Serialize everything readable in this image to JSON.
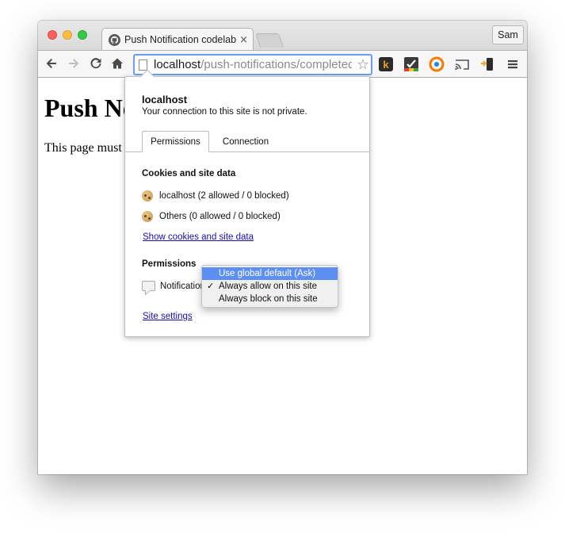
{
  "browser": {
    "tab": {
      "title": "Push Notification codelab",
      "favicon": "github-octocat-icon",
      "close": "×"
    },
    "profile_button": "Sam",
    "address_bar": {
      "host": "localhost",
      "path": "/push-notifications/completed"
    },
    "toolbar_icons": [
      "back-arrow-icon",
      "forward-arrow-icon",
      "reload-icon",
      "home-icon",
      "star-icon",
      "extension-k-icon",
      "extension-checkmark-icon",
      "extension-vpn-icon",
      "cast-icon",
      "extension-phone-icon",
      "menu-icon"
    ]
  },
  "page": {
    "heading": "Push Notifications codelab",
    "paragraph": "This page must be accessed using HTTPS or via localhost."
  },
  "site_info": {
    "host": "localhost",
    "connection_message": "Your connection to this site is not private.",
    "tabs": [
      "Permissions",
      "Connection"
    ],
    "cookies_title": "Cookies and site data",
    "cookie_rows": [
      "localhost (2 allowed / 0 blocked)",
      "Others (0 allowed / 0 blocked)"
    ],
    "show_cookies_link": "Show cookies and site data",
    "permissions_title": "Permissions",
    "notifications_label": "Notifications",
    "site_settings_link": "Site settings"
  },
  "permission_dropdown": {
    "options": [
      "Use global default (Ask)",
      "Always allow on this site",
      "Always block on this site"
    ],
    "highlighted_index": 0,
    "checked_index": 1,
    "check_glyph": "✓"
  },
  "colors": {
    "dropdown_highlight": "#5d8ff2",
    "link": "#1a0dab",
    "omnibox_focus": "#6b9df4"
  }
}
